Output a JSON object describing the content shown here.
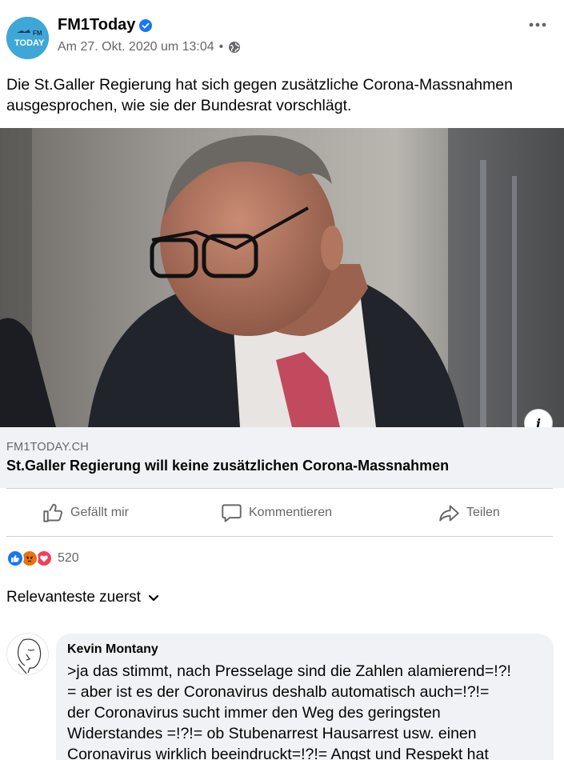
{
  "post": {
    "page_name": "FM1Today",
    "avatar_text": "FM1 TODAY",
    "timestamp": "Am 27. Okt. 2020 um 13:04",
    "separator": "•",
    "text": "Die St.Galler Regierung hat sich gegen zusätzliche Corona-Massnahmen ausgesprochen, wie sie der Bundesrat vorschlägt.",
    "info_symbol": "i"
  },
  "link": {
    "domain": "FM1TODAY.CH",
    "title": "St.Galler Regierung will keine zusätzlichen Corona-Massnahmen"
  },
  "actions": {
    "like": "Gefällt mir",
    "comment": "Kommentieren",
    "share": "Teilen"
  },
  "reactions": {
    "icons": [
      "like-icon",
      "angry-icon",
      "love-icon"
    ],
    "count": "520"
  },
  "sort": {
    "label": "Relevanteste zuerst"
  },
  "comment": {
    "author": "Kevin Montany",
    "text": ">ja das stimmt, nach Presselage sind die Zahlen alamierend=!?!\n= aber ist es der Coronavirus deshalb automatisch auch=!?!=\nder Coronavirus sucht immer den Weg des geringsten\nWiderstandes =!?!= ob Stubenarrest Hausarrest usw. einen\nCoronavirus wirklich beeindruckt=!?!= Angst und Respekt hat"
  },
  "colors": {
    "brand_blue": "#1877f2",
    "secondary_text": "#65676b",
    "link_box_bg": "#f0f2f5",
    "angry": "#e9710f",
    "love": "#f33e58"
  }
}
